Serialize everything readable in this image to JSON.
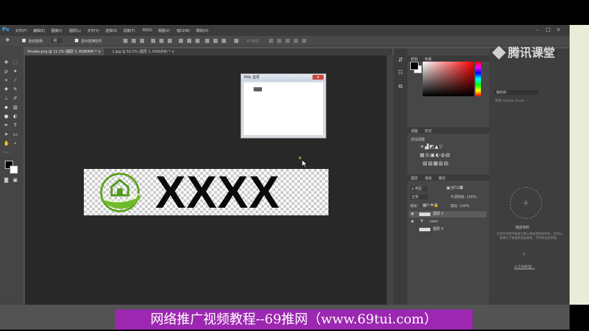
{
  "app": {
    "logo": "Ps"
  },
  "menu": [
    "文件(F)",
    "编辑(E)",
    "图像(I)",
    "图层(L)",
    "文字(Y)",
    "选择(S)",
    "滤镜(T)",
    "3D(D)",
    "视图(V)",
    "窗口(W)",
    "帮助(H)"
  ],
  "window_controls": {
    "min": "–",
    "max": "□",
    "close": "×"
  },
  "options_bar": {
    "auto_select": "自动选择:",
    "layer_select": "组",
    "show_transform": "显示变换控件",
    "mode_3d": "3D 模式:"
  },
  "tabs": [
    {
      "label": "Envato.png @ 11.1% (图层 1, RGB/8#) *",
      "close": "×"
    },
    {
      "label": "1.jpg @ 50.5% (图层 1, RGB/8#) *",
      "close": "×"
    }
  ],
  "dialog": {
    "title": "PNG 选项",
    "close": "x"
  },
  "image": {
    "text": "XXXX"
  },
  "panels": {
    "color_tabs": [
      "颜色",
      "色板"
    ],
    "adjust_tabs": [
      "调整",
      "样式"
    ],
    "add_adjustment": "添加调整",
    "layers_tabs": [
      "图层",
      "通道",
      "路径"
    ],
    "kind_filter": "ρ 类型",
    "blend_mode": "正常",
    "opacity": "不透明度: 100%",
    "lock": "锁定:",
    "fill": "填充: 100%",
    "layers": [
      {
        "name": "图层 1",
        "type": "image",
        "selected": true
      },
      {
        "name": "xxxx",
        "type": "text",
        "selected": false
      },
      {
        "name": "图层 0",
        "type": "image",
        "selected": false
      }
    ]
  },
  "library": {
    "workspace": "基本功能",
    "library_name": "我的库",
    "search": "搜索 Adobe Stock",
    "drop_title": "拖放资料",
    "drop_desc": "在您的文档中拖放元素以添加到您的库中。也可以使用以下按钮来添加颜色、字符样式及其他。",
    "link": "从文档新建..."
  },
  "watermark": "腾讯课堂",
  "banner": "网络推广视频教程--69推网（www.69tui.com）"
}
